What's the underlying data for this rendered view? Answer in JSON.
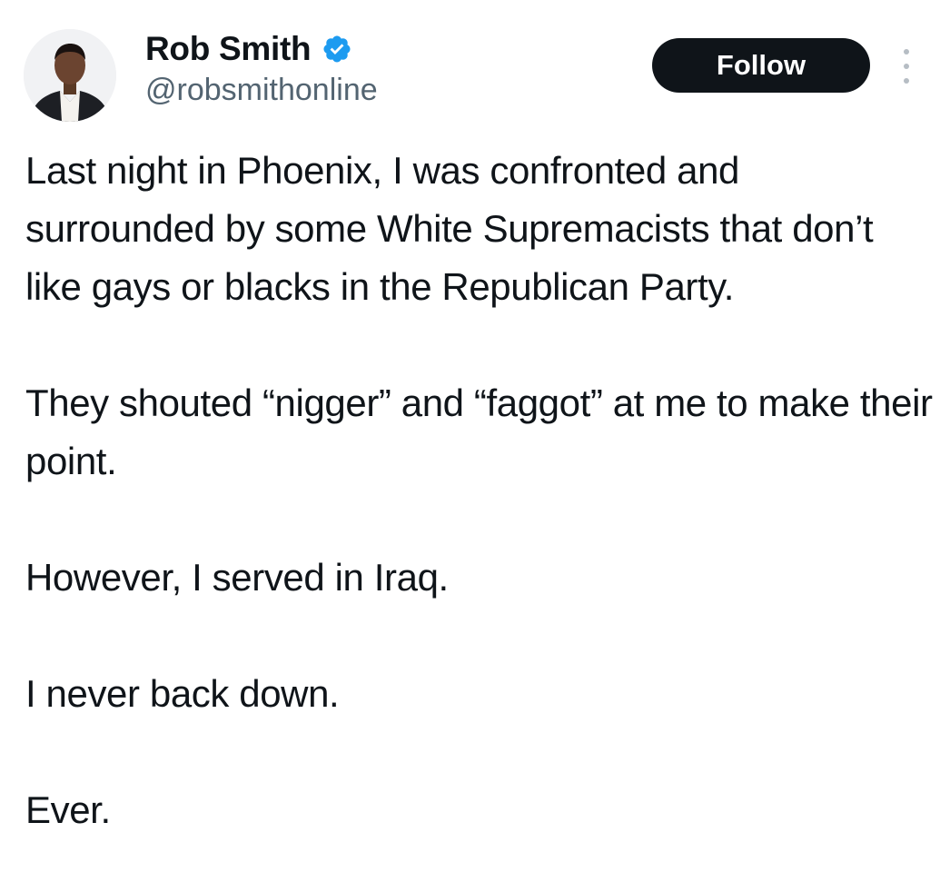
{
  "author": {
    "display_name": "Rob Smith",
    "handle": "@robsmithonline",
    "verified": true,
    "verified_color": "#1d9bf0",
    "avatar_icon": "profile-photo"
  },
  "actions": {
    "follow_label": "Follow",
    "more_icon": "more-vertical-icon"
  },
  "tweet": {
    "paragraphs": [
      "Last night in Phoenix, I was confronted and surrounded by some White Supremacists that don’t like gays or blacks in the Republican Party.",
      "They shouted “nigger” and “faggot” at me to make their point.",
      "However, I served in Iraq.",
      "I never back down.",
      "Ever."
    ]
  },
  "colors": {
    "text": "#0f1419",
    "secondary_text": "#536471",
    "follow_bg": "#0f1419",
    "follow_text": "#ffffff"
  }
}
